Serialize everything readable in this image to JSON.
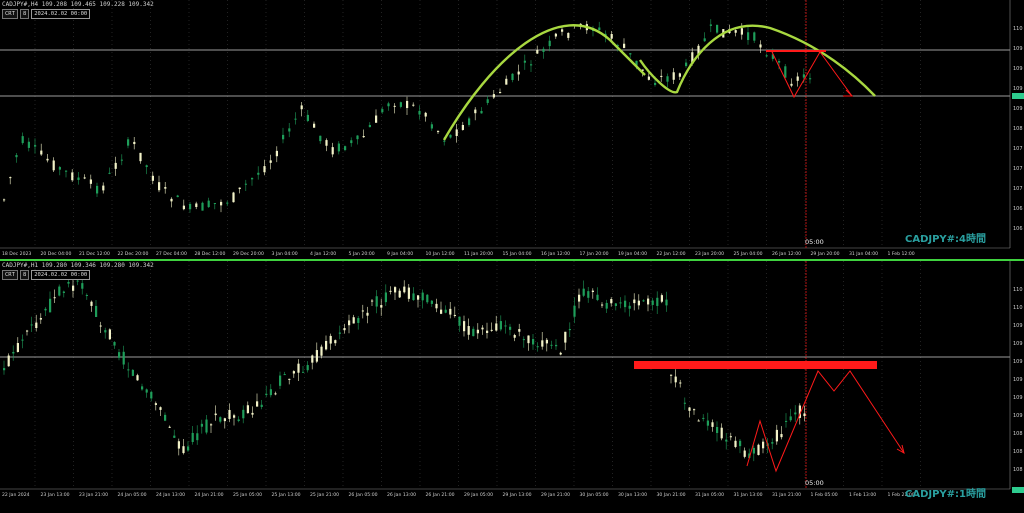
{
  "top": {
    "symbol_line": "CADJPY#,H4  109.208 109.465 109.228 109.342",
    "ctrl_button": "CRT",
    "ctrl_num": "8",
    "datetime": "2024.02.02 00:00",
    "watermark": "CADJPY#:4時間",
    "time_marker": "05:00",
    "x_labels": [
      "18 Dec 2023",
      "20 Dec 04:00",
      "21 Dec 12:00",
      "22 Dec 20:00",
      "27 Dec 04:00",
      "28 Dec 12:00",
      "29 Dec 20:00",
      "3 Jan 04:00",
      "4 Jan 12:00",
      "5 Jan 20:00",
      "9 Jan 04:00",
      "10 Jan 12:00",
      "11 Jan 20:00",
      "15 Jan 04:00",
      "16 Jan 12:00",
      "17 Jan 20:00",
      "19 Jan 04:00",
      "22 Jan 12:00",
      "23 Jan 20:00",
      "25 Jan 04:00",
      "26 Jan 12:00",
      "29 Jan 20:00",
      "31 Jan 04:00",
      "1 Feb 12:00"
    ],
    "y_labels": [
      "110",
      "109",
      "109",
      "109",
      "109",
      "108",
      "107",
      "107",
      "107",
      "106",
      "106"
    ]
  },
  "bottom": {
    "symbol_line": "CADJPY#,H1  109.280 109.346 109.280 109.342",
    "ctrl_button": "CRT",
    "ctrl_num": "8",
    "datetime": "2024.02.02 00:00",
    "watermark": "CADJPY#:1時間",
    "time_marker": "05:00",
    "x_labels": [
      "22 Jan 2024",
      "23 Jan 13:00",
      "23 Jan 21:00",
      "24 Jan 05:00",
      "24 Jan 13:00",
      "24 Jan 21:00",
      "25 Jan 05:00",
      "25 Jan 13:00",
      "25 Jan 21:00",
      "26 Jan 05:00",
      "26 Jan 13:00",
      "26 Jan 21:00",
      "29 Jan 05:00",
      "29 Jan 13:00",
      "29 Jan 21:00",
      "30 Jan 05:00",
      "30 Jan 13:00",
      "30 Jan 21:00",
      "31 Jan 05:00",
      "31 Jan 13:00",
      "31 Jan 21:00",
      "1 Feb 05:00",
      "1 Feb 13:00",
      "1 Feb 21:00"
    ],
    "y_labels": [
      "110",
      "110",
      "109",
      "109",
      "109",
      "109",
      "109",
      "109",
      "108",
      "108",
      "108"
    ]
  },
  "colors": {
    "bull": "#1e9e5a",
    "bear": "#f2f2c8",
    "arc": "#a8d840",
    "red": "#ff1a1a",
    "grid": "#555555",
    "accent": "#2aa0a0"
  }
}
